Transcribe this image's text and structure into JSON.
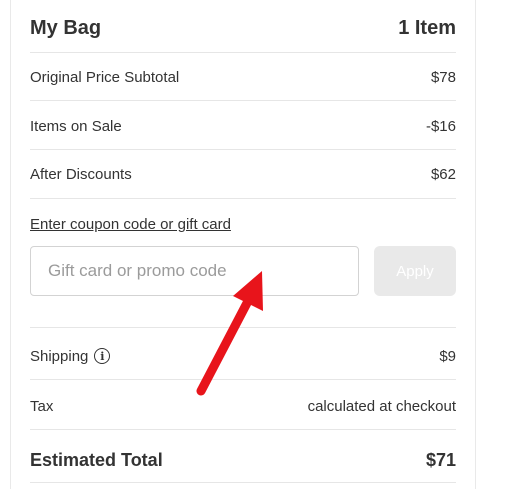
{
  "bag": {
    "title": "My Bag",
    "item_count": "1 Item"
  },
  "summary": {
    "original_label": "Original Price Subtotal",
    "original_value": "$78",
    "sale_label": "Items on Sale",
    "sale_value": "-$16",
    "after_label": "After Discounts",
    "after_value": "$62"
  },
  "coupon": {
    "link_text": "Enter coupon code or gift card",
    "placeholder": "Gift card or promo code",
    "apply_label": "Apply"
  },
  "shipping": {
    "label": "Shipping",
    "info_icon": "info-icon",
    "info_glyph": "i",
    "value": "$9"
  },
  "tax": {
    "label": "Tax",
    "value": "calculated at checkout"
  },
  "total": {
    "label": "Estimated Total",
    "value": "$71"
  },
  "colors": {
    "annotation_arrow": "#e8141b",
    "apply_disabled_bg": "#e9e9e9"
  }
}
